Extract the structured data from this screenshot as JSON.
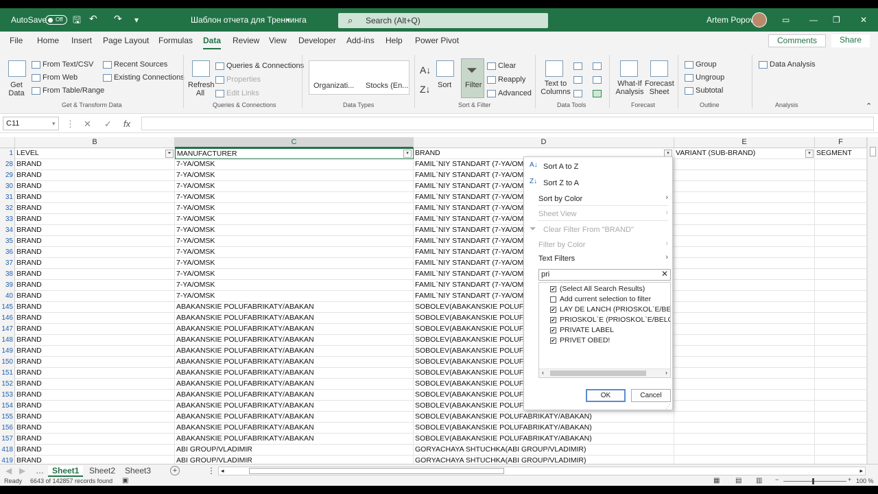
{
  "titlebar": {
    "autosave": "AutoSave",
    "autosave_state": "Off",
    "doc_title": "Шаблон отчета для Треннинга",
    "search_placeholder": "Search (Alt+Q)",
    "user": "Artem Popov"
  },
  "tabs": [
    "File",
    "Home",
    "Insert",
    "Page Layout",
    "Formulas",
    "Data",
    "Review",
    "View",
    "Developer",
    "Add-ins",
    "Help",
    "Power Pivot"
  ],
  "comments": "Comments",
  "share": "Share",
  "ribbon": {
    "get_data": "Get Data",
    "from_text": "From Text/CSV",
    "from_web": "From Web",
    "from_table": "From Table/Range",
    "recent_sources": "Recent Sources",
    "existing_connections": "Existing Connections",
    "group_get": "Get & Transform Data",
    "refresh_all": "Refresh All",
    "queries_connections": "Queries & Connections",
    "properties": "Properties",
    "edit_links": "Edit Links",
    "group_queries": "Queries & Connections",
    "organization": "Organizati...",
    "stocks": "Stocks (En...",
    "group_datatypes": "Data Types",
    "sort": "Sort",
    "filter": "Filter",
    "clear": "Clear",
    "reapply": "Reapply",
    "advanced": "Advanced",
    "group_sortfilter": "Sort & Filter",
    "text_to_columns": "Text to Columns",
    "group_datatools": "Data Tools",
    "what_if": "What-If Analysis",
    "forecast_sheet": "Forecast Sheet",
    "group_forecast": "Forecast",
    "group": "Group",
    "ungroup": "Ungroup",
    "subtotal": "Subtotal",
    "group_outline": "Outline",
    "data_analysis": "Data Analysis",
    "group_analysis": "Analysis"
  },
  "formula": {
    "namebox": "C11",
    "fx": "fx"
  },
  "columns": {
    "b": "B",
    "c": "C",
    "d": "D",
    "e": "E",
    "f": "F"
  },
  "header_row": {
    "num": "1",
    "level": "LEVEL",
    "manufacturer": "MANUFACTURER",
    "brand": "BRAND",
    "variant": "VARIANT (SUB-BRAND)",
    "segment": "SEGMENT"
  },
  "rows": [
    {
      "n": "28",
      "l": "BRAND",
      "m": "7-YA/OMSK",
      "b": "FAMIL`NIY STANDART (7-YA/OM"
    },
    {
      "n": "29",
      "l": "BRAND",
      "m": "7-YA/OMSK",
      "b": "FAMIL`NIY STANDART (7-YA/OM"
    },
    {
      "n": "30",
      "l": "BRAND",
      "m": "7-YA/OMSK",
      "b": "FAMIL`NIY STANDART (7-YA/OM"
    },
    {
      "n": "31",
      "l": "BRAND",
      "m": "7-YA/OMSK",
      "b": "FAMIL`NIY STANDART (7-YA/OM"
    },
    {
      "n": "32",
      "l": "BRAND",
      "m": "7-YA/OMSK",
      "b": "FAMIL`NIY STANDART (7-YA/OM"
    },
    {
      "n": "33",
      "l": "BRAND",
      "m": "7-YA/OMSK",
      "b": "FAMIL`NIY STANDART (7-YA/OM"
    },
    {
      "n": "34",
      "l": "BRAND",
      "m": "7-YA/OMSK",
      "b": "FAMIL`NIY STANDART (7-YA/OM"
    },
    {
      "n": "35",
      "l": "BRAND",
      "m": "7-YA/OMSK",
      "b": "FAMIL`NIY STANDART (7-YA/OM"
    },
    {
      "n": "36",
      "l": "BRAND",
      "m": "7-YA/OMSK",
      "b": "FAMIL`NIY STANDART (7-YA/OM"
    },
    {
      "n": "37",
      "l": "BRAND",
      "m": "7-YA/OMSK",
      "b": "FAMIL`NIY STANDART (7-YA/OM"
    },
    {
      "n": "38",
      "l": "BRAND",
      "m": "7-YA/OMSK",
      "b": "FAMIL`NIY STANDART (7-YA/OM"
    },
    {
      "n": "39",
      "l": "BRAND",
      "m": "7-YA/OMSK",
      "b": "FAMIL`NIY STANDART (7-YA/OM"
    },
    {
      "n": "40",
      "l": "BRAND",
      "m": "7-YA/OMSK",
      "b": "FAMIL`NIY STANDART (7-YA/OM"
    },
    {
      "n": "145",
      "l": "BRAND",
      "m": "ABAKANSKIE POLUFABRIKATY/ABAKAN",
      "b": "SOBOLEV(ABAKANSKIE POLUFAE"
    },
    {
      "n": "146",
      "l": "BRAND",
      "m": "ABAKANSKIE POLUFABRIKATY/ABAKAN",
      "b": "SOBOLEV(ABAKANSKIE POLUFAE"
    },
    {
      "n": "147",
      "l": "BRAND",
      "m": "ABAKANSKIE POLUFABRIKATY/ABAKAN",
      "b": "SOBOLEV(ABAKANSKIE POLUFAE"
    },
    {
      "n": "148",
      "l": "BRAND",
      "m": "ABAKANSKIE POLUFABRIKATY/ABAKAN",
      "b": "SOBOLEV(ABAKANSKIE POLUFAE"
    },
    {
      "n": "149",
      "l": "BRAND",
      "m": "ABAKANSKIE POLUFABRIKATY/ABAKAN",
      "b": "SOBOLEV(ABAKANSKIE POLUFAE"
    },
    {
      "n": "150",
      "l": "BRAND",
      "m": "ABAKANSKIE POLUFABRIKATY/ABAKAN",
      "b": "SOBOLEV(ABAKANSKIE POLUFAE"
    },
    {
      "n": "151",
      "l": "BRAND",
      "m": "ABAKANSKIE POLUFABRIKATY/ABAKAN",
      "b": "SOBOLEV(ABAKANSKIE POLUFAE"
    },
    {
      "n": "152",
      "l": "BRAND",
      "m": "ABAKANSKIE POLUFABRIKATY/ABAKAN",
      "b": "SOBOLEV(ABAKANSKIE POLUFAE"
    },
    {
      "n": "153",
      "l": "BRAND",
      "m": "ABAKANSKIE POLUFABRIKATY/ABAKAN",
      "b": "SOBOLEV(ABAKANSKIE POLUFAE"
    },
    {
      "n": "154",
      "l": "BRAND",
      "m": "ABAKANSKIE POLUFABRIKATY/ABAKAN",
      "b": "SOBOLEV(ABAKANSKIE POLUFAE"
    },
    {
      "n": "155",
      "l": "BRAND",
      "m": "ABAKANSKIE POLUFABRIKATY/ABAKAN",
      "b": "SOBOLEV(ABAKANSKIE POLUFABRIKATY/ABAKAN)"
    },
    {
      "n": "156",
      "l": "BRAND",
      "m": "ABAKANSKIE POLUFABRIKATY/ABAKAN",
      "b": "SOBOLEV(ABAKANSKIE POLUFABRIKATY/ABAKAN)"
    },
    {
      "n": "157",
      "l": "BRAND",
      "m": "ABAKANSKIE POLUFABRIKATY/ABAKAN",
      "b": "SOBOLEV(ABAKANSKIE POLUFABRIKATY/ABAKAN)"
    },
    {
      "n": "418",
      "l": "BRAND",
      "m": "ABI GROUP/VLADIMIR",
      "b": "GORYACHAYA SHTUCHKA(ABI GROUP/VLADIMIR)"
    },
    {
      "n": "419",
      "l": "BRAND",
      "m": "ABI GROUP/VLADIMIR",
      "b": "GORYACHAYA SHTUCHKA(ABI GROUP/VLADIMIR)"
    }
  ],
  "dropdown": {
    "sort_az": "Sort A to Z",
    "sort_za": "Sort Z to A",
    "sort_color": "Sort by Color",
    "sheet_view": "Sheet View",
    "clear_filter": "Clear Filter From \"BRAND\"",
    "filter_color": "Filter by Color",
    "text_filters": "Text Filters",
    "search_value": "pri",
    "items": [
      {
        "label": "(Select All Search Results)",
        "checked": "✔"
      },
      {
        "label": "Add current selection to filter",
        "checked": ""
      },
      {
        "label": "LAY DE LANCH (PRIOSKOL`E/BELGO",
        "checked": "✔"
      },
      {
        "label": "PRIOSKOL`E (PRIOSKOL`E/BELGOROD",
        "checked": "✔"
      },
      {
        "label": "PRIVATE LABEL",
        "checked": "✔"
      },
      {
        "label": "PRIVET OBED!",
        "checked": "✔"
      }
    ],
    "ok": "OK",
    "cancel": "Cancel"
  },
  "sheets": [
    "Sheet1",
    "Sheet2",
    "Sheet3"
  ],
  "status": {
    "ready": "Ready",
    "records": "6643 of 142857 records found",
    "zoom": "100 %"
  },
  "colors": {
    "accent": "#217346"
  }
}
